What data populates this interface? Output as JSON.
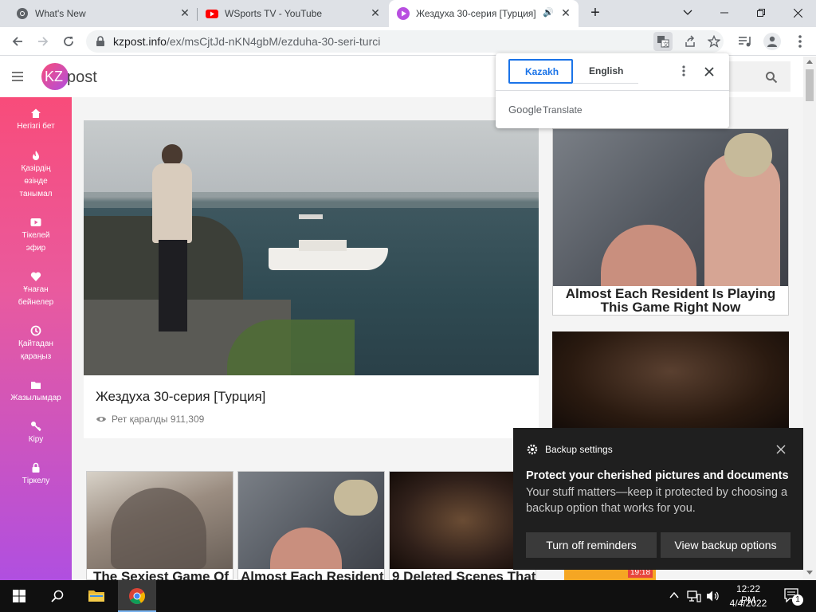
{
  "browser": {
    "tabs": [
      {
        "title": "What's New",
        "icon": "chrome-icon"
      },
      {
        "title": "WSports TV - YouTube",
        "icon": "youtube-icon"
      },
      {
        "title": "Жездуха 30-серия [Турция]",
        "icon": "play-icon",
        "active": true
      }
    ],
    "url_domain": "kzpost.info",
    "url_path": "/ex/msCjtJd-nKN4gbM/ezduha-30-seri-turci"
  },
  "translate": {
    "lang_source": "Kazakh",
    "lang_target": "English",
    "brand": "Google",
    "service": "Translate"
  },
  "site": {
    "logo_kz": "KZ",
    "logo_post": "post",
    "sidebar": [
      {
        "label": "Негізгі бет",
        "icon": "home-icon"
      },
      {
        "label": "Қазірдің өзінде танымал",
        "icon": "flame-icon"
      },
      {
        "label": "Тікелей эфир",
        "icon": "live-icon"
      },
      {
        "label": "Ұнаған бейнелер",
        "icon": "heart-icon"
      },
      {
        "label": "Қайтадан қараңыз",
        "icon": "history-icon"
      },
      {
        "label": "Жазылымдар",
        "icon": "folder-icon"
      },
      {
        "label": "Кіру",
        "icon": "key-icon"
      },
      {
        "label": "Тіркелу",
        "icon": "lock-icon"
      }
    ],
    "main_video": {
      "title": "Жездуха 30-серия [Турция]",
      "views_label": "Рет қаралды 911,309"
    },
    "right_ads": [
      {
        "title": "Almost Each Resident Is Playing This Game Right Now"
      }
    ],
    "bottom_cards": [
      {
        "title": "The Sexiest Game Of"
      },
      {
        "title": "Almost Each Resident"
      },
      {
        "title": "9 Deleted Scenes That"
      }
    ],
    "time_badge": "19:18"
  },
  "toast": {
    "header": "Backup settings",
    "title": "Protect your cherished pictures and documents",
    "body": "Your stuff matters—keep it protected by choosing a backup option that works for you.",
    "btn_off": "Turn off reminders",
    "btn_view": "View backup options"
  },
  "taskbar": {
    "time": "12:22 PM",
    "date": "4/4/2022",
    "notif_count": "1"
  }
}
